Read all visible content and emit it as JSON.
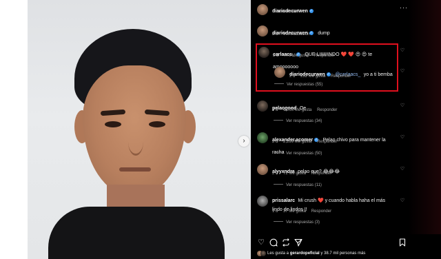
{
  "post": {
    "author": "diariodecurwen",
    "ai_label": "Contenido de IA",
    "more_icon": "more-dots-icon",
    "caption": "dump",
    "caption_time": "2 d",
    "translate_link": "Ver traducción"
  },
  "comments": [
    {
      "user": "carlaacs_",
      "verified": true,
      "text": "QUE LIIIIIIINDO ❤️ ❤️ 😍 😍 te amooooooo",
      "time": "2 d",
      "likes": "776 Me gusta",
      "reply_label": "Responder",
      "avatar": "dark"
    },
    {
      "user": "diariodecurwen",
      "verified": true,
      "mention": "@carlaacs_",
      "text": "yo a ti bemba",
      "time": "2 d",
      "likes": "232 Me gusta",
      "reply_label": "Responder",
      "avatar": "light"
    },
    {
      "user": "pelaogood",
      "verified": false,
      "text": "Oe",
      "time": "1 d",
      "likes": "1,055 Me gusta",
      "reply_label": "Responder",
      "view_replies": "Ver respuestas (34)"
    },
    {
      "user": "alexander.acomer",
      "verified": true,
      "text": "Pelao chivo para mantener la racha",
      "time": "2 d",
      "likes": "2,299 Me gusta",
      "reply_label": "Responder",
      "view_replies": "Ver respuestas (50)"
    },
    {
      "user": "alyyxndra",
      "verified": false,
      "text": "pelao que? 😂😂😂",
      "time": "2 d",
      "likes": "72 Me gusta",
      "reply_label": "Responder",
      "view_replies": "Ver respuestas (11)"
    },
    {
      "user": "prissalarc",
      "verified": false,
      "text": "Mi crush ❤️ y cuando habla haha el más lindo de lindos !!",
      "time": "1 d",
      "likes": "37 Me gusta",
      "reply_label": "Responder",
      "view_replies": "Ver respuestas (3)"
    }
  ],
  "carla_thread_replies": "Ver respuestas (55)",
  "footer": {
    "likes_prefix": "Les gusta a",
    "liked_by": "gerardopeficial",
    "likes_suffix": "y 38.7 mil personas más"
  },
  "icons": {
    "like": "heart-icon",
    "comment": "comment-icon",
    "repost": "repost-icon",
    "share": "send-icon",
    "save": "bookmark-icon",
    "next": "chevron-right-icon"
  },
  "colors": {
    "highlight": "#e0101e",
    "verified": "#3897f0",
    "panel_bg": "#000000"
  }
}
